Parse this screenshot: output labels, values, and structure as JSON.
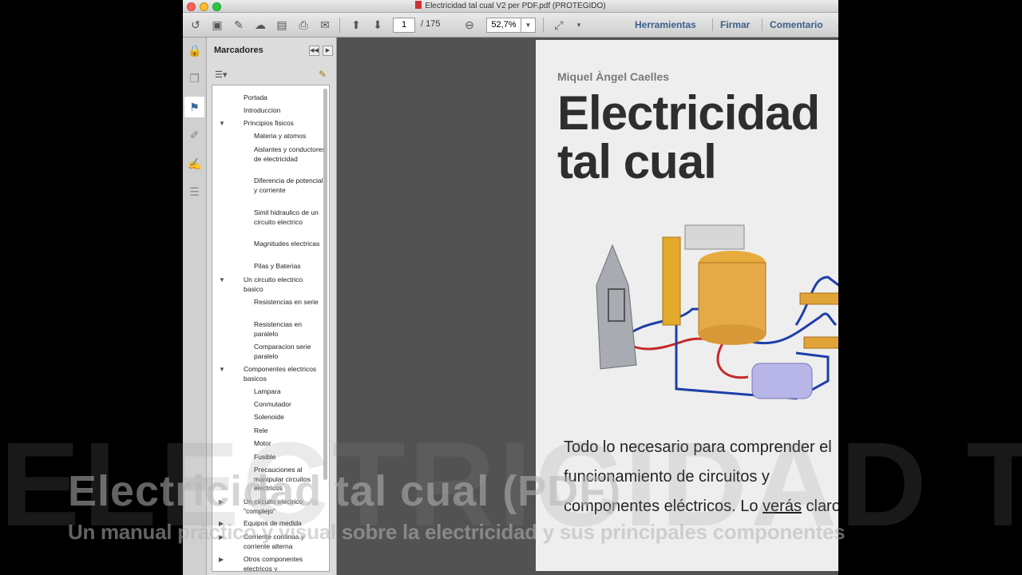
{
  "window": {
    "title": "Electricidad tal cual V2 per PDF.pdf (PROTEGIDO)"
  },
  "toolbar": {
    "page_current": "1",
    "page_total": "/ 175",
    "zoom": "52,7%",
    "links": [
      "Herramientas",
      "Firmar",
      "Comentario"
    ]
  },
  "panel": {
    "title": "Marcadores"
  },
  "bookmarks": [
    "Portada",
    "Introduccion",
    "Principios fisicos",
    "Materia y atomos",
    "Aislantes y conductores de electricidad",
    "Diferencia de potencial y corriente",
    "Simil hidraulico de un circuito electrico",
    "Magnitudes electricas",
    "Pilas y Baterias",
    "Un circuito electrico basico",
    "Resistencias en serie",
    "Resistencias en paralelo",
    "Comparacion serie paralelo",
    "Componentes electricos basicos",
    "Lampara",
    "Conmutador",
    "Solenoide",
    "Rele",
    "Motor",
    "Fusible",
    "Precauciones al manipular circuitos electricos",
    "Un circuito electrico \"complejo\"",
    "Equipos de medida",
    "Corriente continua y corriente alterna",
    "Otros componentes electricos y"
  ],
  "document": {
    "author": "Miquel Àngel Caelles",
    "title_line1": "Electricidad",
    "title_line2": "tal cual",
    "desc_line1": "Todo lo necesario para comprender el",
    "desc_line2": "funcionamiento de circuitos y",
    "desc_line3a": "componentes eléctricos. Lo ",
    "desc_line3b": "verás",
    "desc_line3c": " claro"
  },
  "overlay": {
    "watermark": "ELECTRICIDAD TAL CUAL (PDF)",
    "title": "Electricidad tal cual (PDF)",
    "subtitle": "Un manual práctico y visual sobre la electricidad y sus principales componentes"
  },
  "colors": {
    "accent_link": "#3a5f8c",
    "bookmark_icon": "#7c8a97"
  }
}
